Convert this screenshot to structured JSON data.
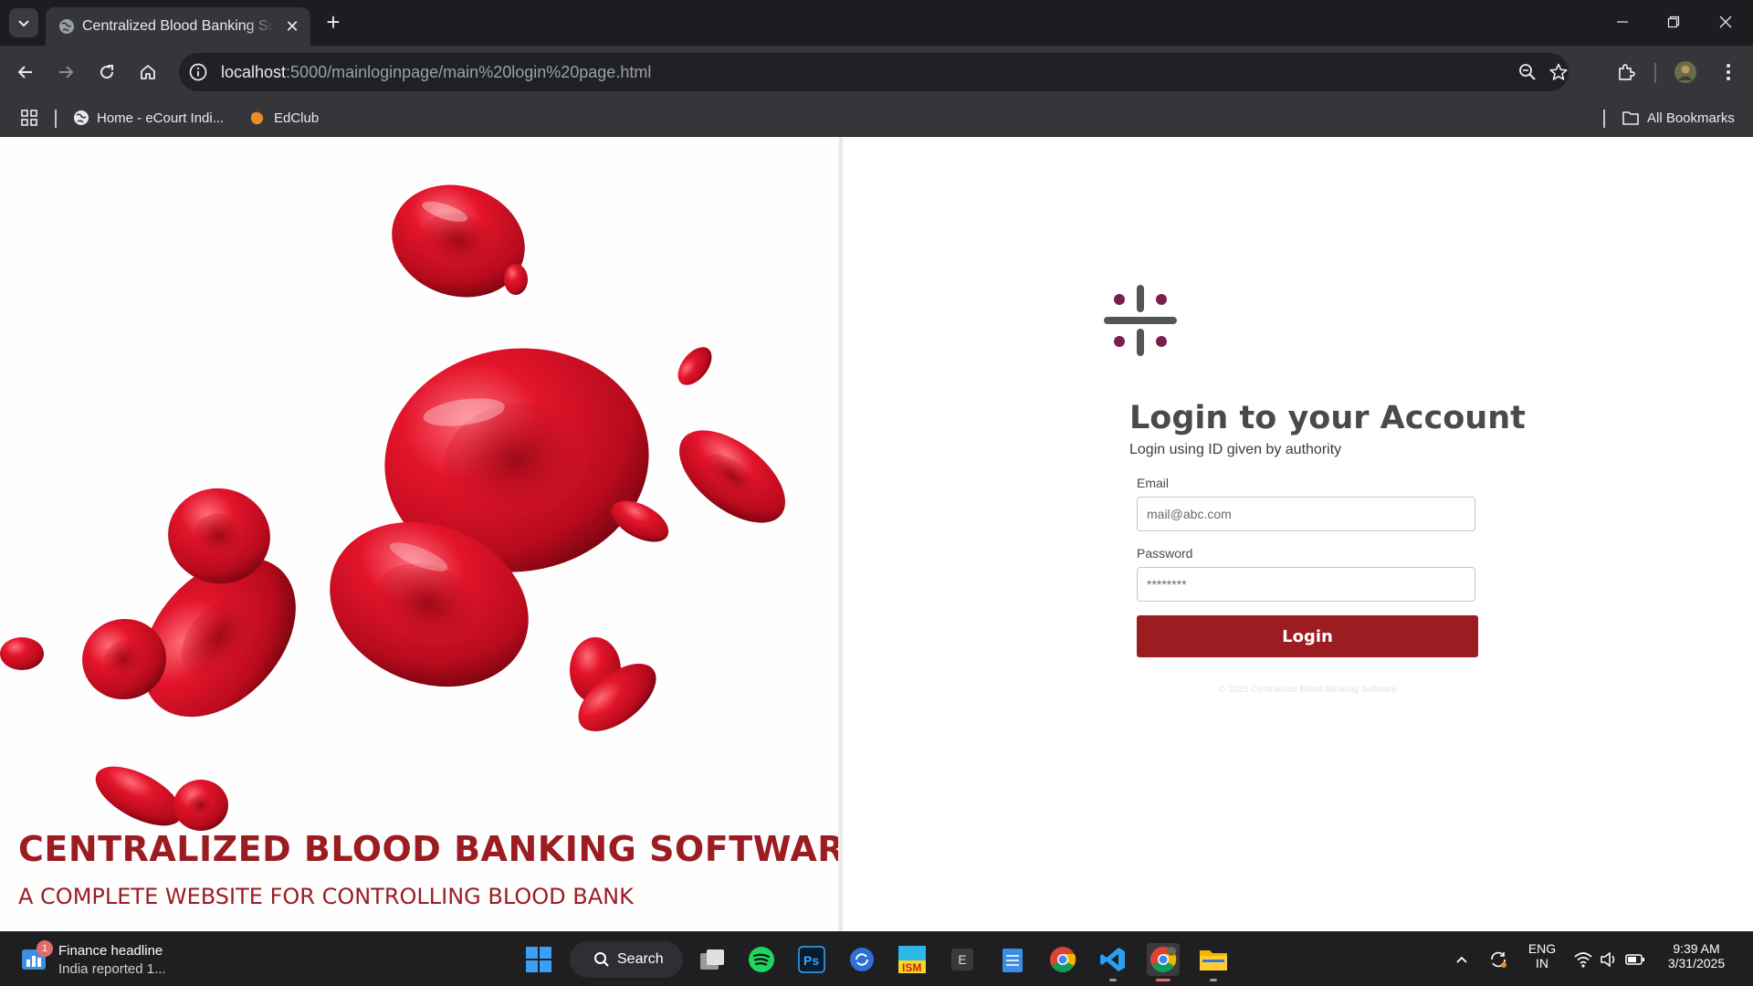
{
  "browser": {
    "tab_title": "Centralized Blood Banking Software",
    "tab_close": "✕",
    "new_tab": "+",
    "url_host": "localhost",
    "url_path": ":5000/mainloginpage/main%20login%20page.html",
    "bookmarks": [
      {
        "label": "Home - eCourt Indi...",
        "icon": "globe-icon"
      },
      {
        "label": "EdClub",
        "icon": "edclub-icon"
      }
    ],
    "all_bookmarks": "All Bookmarks"
  },
  "brand": {
    "title": "CENTRALIZED BLOOD BANKING SOFTWARE",
    "subtitle": "A COMPLETE WEBSITE FOR CONTROLLING BLOOD BANK",
    "accent": "#9b1d22"
  },
  "login": {
    "heading": "Login to your Account",
    "subheading": "Login using ID given by authority",
    "email_label": "Email",
    "email_placeholder": "mail@abc.com",
    "password_label": "Password",
    "password_placeholder": "********",
    "button": "Login",
    "copyright": "© 2025 Centralized Blood Banking Software"
  },
  "taskbar": {
    "widget_badge": "1",
    "widget_title": "Finance headline",
    "widget_text": "India reported 1...",
    "search_label": "Search",
    "app_letter": "E",
    "lang_top": "ENG",
    "lang_bottom": "IN",
    "time": "9:39 AM",
    "date": "3/31/2025"
  }
}
